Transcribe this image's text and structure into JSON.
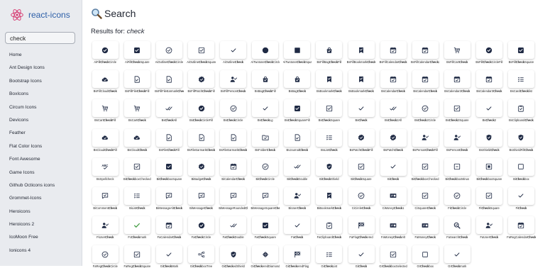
{
  "sidebar": {
    "logo_text": "react-icons",
    "search_value": "check",
    "items": [
      "Home",
      "Ant Design Icons",
      "Bootstrap Icons",
      "BoxIcons",
      "Circum Icons",
      "Devicons",
      "Feather",
      "Flat Color Icons",
      "Font Awesome",
      "Game Icons",
      "Github Octicons icons",
      "Grommet-Icons",
      "Heroicons",
      "Heroicons 2",
      "IcoMoon Free",
      "Ionicons 4"
    ]
  },
  "main": {
    "title": "Search",
    "results_prefix": "Results for: ",
    "query": "check"
  },
  "icons": [
    {
      "name": "AiFillCheckCircle",
      "icon": "check-circle-filled"
    },
    {
      "name": "AiFillCheckSquare",
      "icon": "check-square-filled"
    },
    {
      "name": "AiOutlineCheckCircle",
      "icon": "check-circle-outline"
    },
    {
      "name": "AiOutlineCheckSquare",
      "icon": "check-square-outline"
    },
    {
      "name": "AiOutlineCheck",
      "icon": "check"
    },
    {
      "name": "AiTwotoneCheckCircle",
      "icon": "circle-filled"
    },
    {
      "name": "AiTwotoneCheckSquare",
      "icon": "square-filled"
    },
    {
      "name": "BsFillBagCheckFill",
      "icon": "bag-check"
    },
    {
      "name": "BsFillBookmarkCheck",
      "icon": "bookmark-check"
    },
    {
      "name": "BsFillCalendarCheck",
      "icon": "calendar-check"
    },
    {
      "name": "BsFillCalendarCheck2",
      "icon": "calendar-check"
    },
    {
      "name": "BsFillCartCheck",
      "icon": "cart-check"
    },
    {
      "name": "BsFillCheckCircleFill",
      "icon": "check-circle-filled"
    },
    {
      "name": "BsFillCheckSquare",
      "icon": "check-square-filled"
    },
    {
      "name": "BsFillCloudCheck",
      "icon": "cloud-check"
    },
    {
      "name": "BsFillFileCheckFill",
      "icon": "file-check"
    },
    {
      "name": "BsFillFileEarmarkCheck",
      "icon": "file-check"
    },
    {
      "name": "BsFillPatchCheckFill",
      "icon": "badge-check"
    },
    {
      "name": "BsFillPersonCheck",
      "icon": "person-check"
    },
    {
      "name": "BsBagCheckFill",
      "icon": "bag-check"
    },
    {
      "name": "BsBagCheck",
      "icon": "bag-check"
    },
    {
      "name": "BsBookmarkCheck",
      "icon": "bookmark-check"
    },
    {
      "name": "BsBookmarkCheck",
      "icon": "bookmark-check"
    },
    {
      "name": "BsCalendarCheck",
      "icon": "calendar-check"
    },
    {
      "name": "BsCalendarCheck",
      "icon": "calendar-check"
    },
    {
      "name": "BsCalendar2Check",
      "icon": "calendar-check"
    },
    {
      "name": "BsCalendar3Check",
      "icon": "calendar-check"
    },
    {
      "name": "BsCardChecklist",
      "icon": "checklist"
    },
    {
      "name": "BsCartCheckFill",
      "icon": "cart-check"
    },
    {
      "name": "BsCartCheck",
      "icon": "cart-check"
    },
    {
      "name": "BsCheckAll",
      "icon": "check-all"
    },
    {
      "name": "BsCheckCircleFill",
      "icon": "check-circle-filled"
    },
    {
      "name": "BsCheckCircle",
      "icon": "check-circle-outline"
    },
    {
      "name": "BsCheckLg",
      "icon": "check"
    },
    {
      "name": "BsCheckSquareFill",
      "icon": "check-square-filled"
    },
    {
      "name": "BsCheckSquare",
      "icon": "check-square-outline"
    },
    {
      "name": "BsCheck",
      "icon": "check"
    },
    {
      "name": "BsCheck2All",
      "icon": "check-all"
    },
    {
      "name": "BsCheck2Circle",
      "icon": "check-circle-outline"
    },
    {
      "name": "BsCheck2Square",
      "icon": "check-square-outline"
    },
    {
      "name": "BsCheck2",
      "icon": "check"
    },
    {
      "name": "BsClipboardCheck",
      "icon": "clipboard-check"
    },
    {
      "name": "BsCloudCheckFill",
      "icon": "cloud-check"
    },
    {
      "name": "BsCloudCheck",
      "icon": "cloud-check"
    },
    {
      "name": "BsFileCheckFill",
      "icon": "file-check"
    },
    {
      "name": "BsFileEarmarkCheck",
      "icon": "file-check"
    },
    {
      "name": "BsFileEarmarkCheck",
      "icon": "file-check"
    },
    {
      "name": "BsFolderCheck",
      "icon": "folder-check"
    },
    {
      "name": "BsJournalCheck",
      "icon": "file-check"
    },
    {
      "name": "BsListCheck",
      "icon": "checklist"
    },
    {
      "name": "BsPatchCheckFill",
      "icon": "badge-check"
    },
    {
      "name": "BsPatchCheck",
      "icon": "badge-check"
    },
    {
      "name": "BsPersonCheckFill",
      "icon": "person-check"
    },
    {
      "name": "BsPersonCheck",
      "icon": "person-check"
    },
    {
      "name": "BsShieldCheck",
      "icon": "shield-check"
    },
    {
      "name": "BsShieldFillCheck",
      "icon": "shield-check"
    },
    {
      "name": "BsSpellcheck",
      "icon": "spellcheck"
    },
    {
      "name": "BiCheckboxChecked",
      "icon": "check-square-outline"
    },
    {
      "name": "BiCheckboxSquare",
      "icon": "check-square-filled"
    },
    {
      "name": "BiBadgeCheck",
      "icon": "badge-check"
    },
    {
      "name": "BiCalendarCheck",
      "icon": "calendar-check"
    },
    {
      "name": "BiCheckCircle",
      "icon": "check-circle-outline"
    },
    {
      "name": "BiCheckDouble",
      "icon": "check-all"
    },
    {
      "name": "BiCheckShield",
      "icon": "shield-check"
    },
    {
      "name": "BiCheckSquare",
      "icon": "check-square-outline"
    },
    {
      "name": "BiCheck",
      "icon": "check"
    },
    {
      "name": "BiCheckboxChecked",
      "icon": "check-square-outline"
    },
    {
      "name": "BiCheckboxMinus",
      "icon": "square-minus"
    },
    {
      "name": "BiCheckboxSquare",
      "icon": "square-dot"
    },
    {
      "name": "BiCheckbox",
      "icon": "square-outline"
    },
    {
      "name": "BiCommentCheck",
      "icon": "comment-check"
    },
    {
      "name": "BiListCheck",
      "icon": "checklist"
    },
    {
      "name": "BiMessageAltCheck",
      "icon": "comment-check"
    },
    {
      "name": "BiMessageCheck",
      "icon": "comment-check"
    },
    {
      "name": "BiMessageRoundedCheck",
      "icon": "comment-check"
    },
    {
      "name": "BiMessageSquareCheck",
      "icon": "comment-check"
    },
    {
      "name": "BiUserCheck",
      "icon": "person-check"
    },
    {
      "name": "BiBookmarkCheck",
      "icon": "bookmark-check"
    },
    {
      "name": "CiCircleCheck",
      "icon": "check-circle-outline"
    },
    {
      "name": "CiMoneyCheck1",
      "icon": "money-check"
    },
    {
      "name": "CiSquareCheck",
      "icon": "check-square-outline"
    },
    {
      "name": "FiCheckCircle",
      "icon": "check-circle-outline"
    },
    {
      "name": "FiCheckSquare",
      "icon": "check-square-outline"
    },
    {
      "name": "FiCheck",
      "icon": "check"
    },
    {
      "name": "FiUserCheck",
      "icon": "person-check"
    },
    {
      "name": "FcCheckmark",
      "icon": "check-green"
    },
    {
      "name": "FaCalendarCheck",
      "icon": "calendar-check"
    },
    {
      "name": "FaCheckCircle",
      "icon": "check-circle-filled"
    },
    {
      "name": "FaCheckDouble",
      "icon": "check-all"
    },
    {
      "name": "FaCheckSquare",
      "icon": "check-square-filled"
    },
    {
      "name": "FaCheck",
      "icon": "check"
    },
    {
      "name": "FaClipboardCheck",
      "icon": "clipboard-check"
    },
    {
      "name": "FaFlagCheckered",
      "icon": "flag-checkered"
    },
    {
      "name": "FaMoneyCheckAlt",
      "icon": "money-check"
    },
    {
      "name": "FaMoneyCheck",
      "icon": "money-check"
    },
    {
      "name": "FaSearchCheck",
      "icon": "search-check"
    },
    {
      "name": "FaUserCheck",
      "icon": "person-check"
    },
    {
      "name": "FaRegCalendarCheck",
      "icon": "calendar-check"
    },
    {
      "name": "FaRegCheckCircle",
      "icon": "check-circle-outline"
    },
    {
      "name": "FaRegCheckSquare",
      "icon": "check-square-outline"
    },
    {
      "name": "GiCheckMark",
      "icon": "check"
    },
    {
      "name": "GiCheckboxTree",
      "icon": "tree"
    },
    {
      "name": "GiCheckedShield",
      "icon": "shield-check"
    },
    {
      "name": "GiCheckeredDiamond",
      "icon": "diamond-check"
    },
    {
      "name": "GiCheckeredFlag",
      "icon": "flag-checkered"
    },
    {
      "name": "GiCheckList",
      "icon": "checklist"
    },
    {
      "name": "GiCheck",
      "icon": "check"
    },
    {
      "name": "GrCheckboxSelected",
      "icon": "check-square-outline"
    },
    {
      "name": "GrCheckbox",
      "icon": "square-outline"
    },
    {
      "name": "GrCheckmark",
      "icon": "check"
    }
  ]
}
